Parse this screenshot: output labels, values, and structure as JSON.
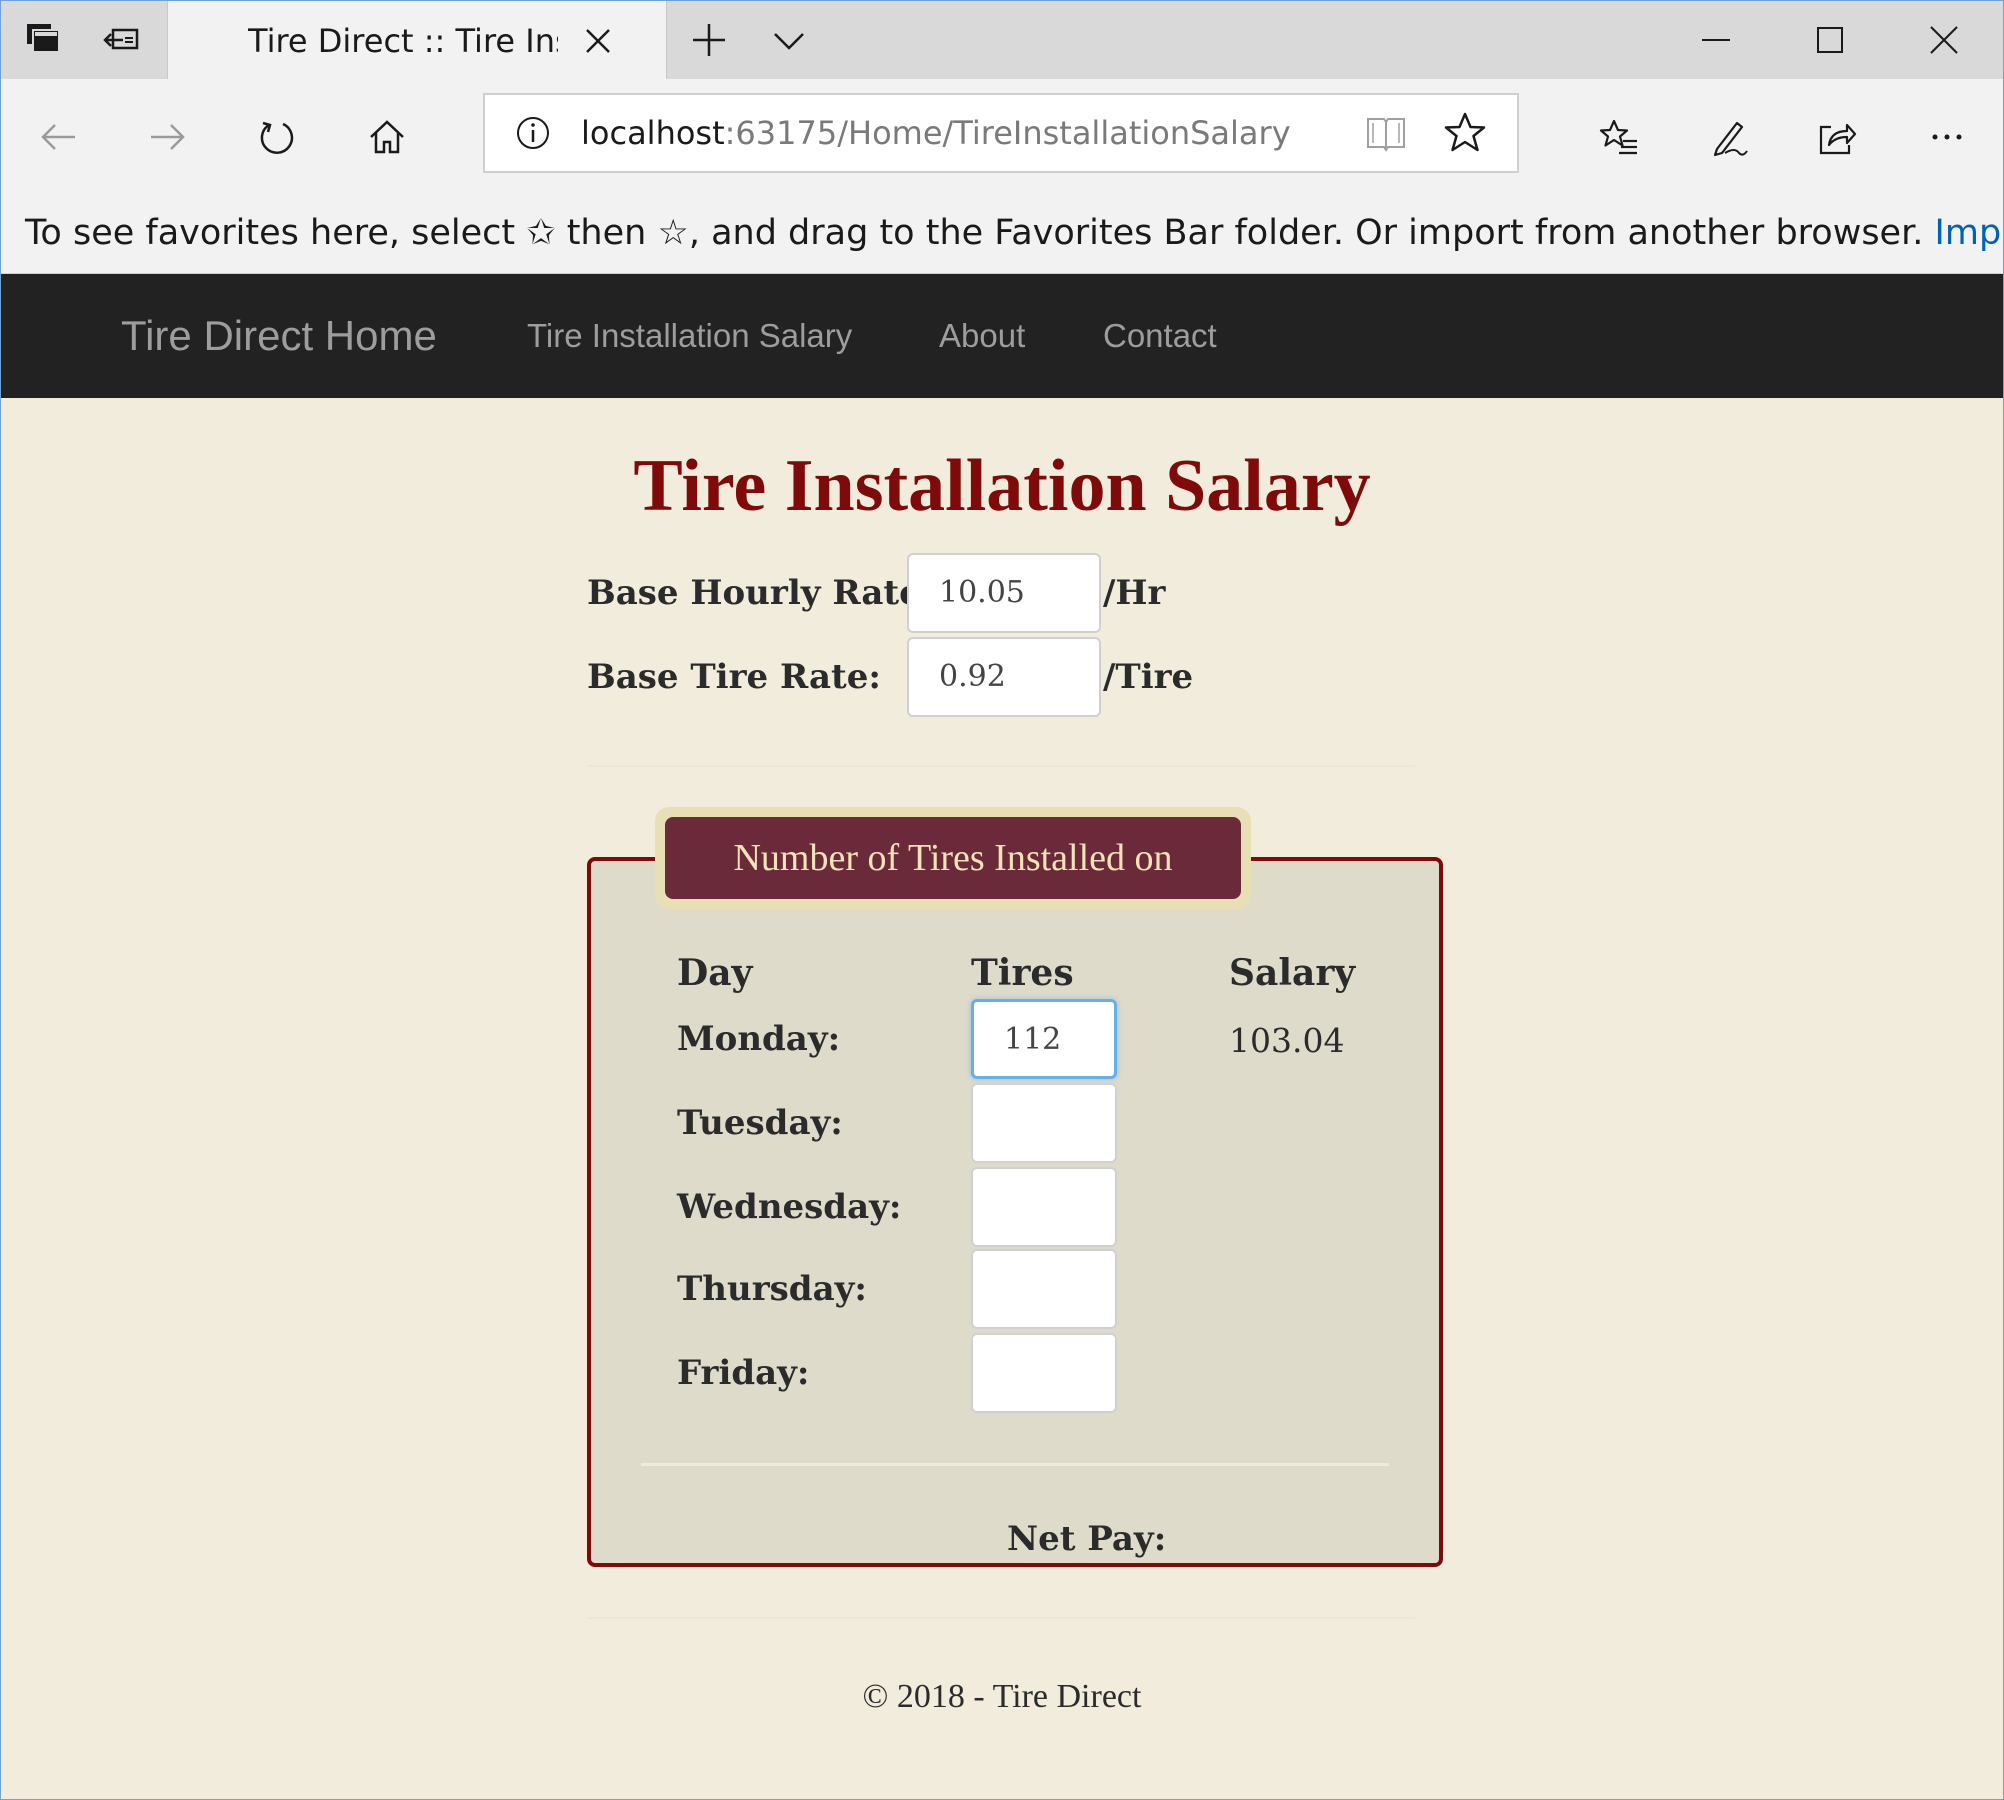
{
  "browser": {
    "tab_title": "Tire Direct :: Tire Installa",
    "url_host": "localhost",
    "url_path": ":63175/Home/TireInstallationSalary",
    "favorites_message": "To see favorites here, select  ✩  then ☆, and drag to the Favorites Bar folder. Or import from another browser.",
    "favorites_link": "Import fav",
    "icons": {
      "tab_preview": "tab-preview-icon",
      "tab_aside": "set-tabs-aside-icon",
      "tab_close": "close-icon",
      "new_tab": "plus-icon",
      "tab_menu": "chevron-down-icon",
      "minimize": "minimize-icon",
      "maximize": "maximize-icon",
      "close_window": "close-icon",
      "back": "back-arrow-icon",
      "forward": "forward-arrow-icon",
      "refresh": "refresh-icon",
      "home": "home-icon",
      "site_info": "info-icon",
      "reading_view": "book-icon",
      "favorite": "star-icon",
      "favorites_hub": "favorites-list-icon",
      "notes": "pen-icon",
      "share": "share-icon",
      "more": "ellipsis-icon"
    }
  },
  "nav": {
    "brand": "Tire Direct Home",
    "links": [
      "Tire Installation Salary",
      "About",
      "Contact"
    ]
  },
  "page": {
    "title": "Tire Installation Salary",
    "base_hourly_label": "Base Hourly Rate:",
    "base_hourly_value": "10.05",
    "base_hourly_unit": "/Hr",
    "base_tire_label": "Base Tire Rate:",
    "base_tire_value": "0.92",
    "base_tire_unit": "/Tire",
    "legend": "Number of Tires Installed on",
    "columns": {
      "day": "Day",
      "tires": "Tires",
      "salary": "Salary"
    },
    "days": [
      {
        "label": "Monday:",
        "tires": "112",
        "salary": "103.04"
      },
      {
        "label": "Tuesday:",
        "tires": "",
        "salary": ""
      },
      {
        "label": "Wednesday:",
        "tires": "",
        "salary": ""
      },
      {
        "label": "Thursday:",
        "tires": "",
        "salary": ""
      },
      {
        "label": "Friday:",
        "tires": "",
        "salary": ""
      }
    ],
    "net_pay_label": "Net Pay:",
    "footer": "© 2018 - Tire Direct"
  },
  "colors": {
    "title": "#7f0a0a",
    "navbar": "#222222",
    "page_bg": "#f2ecdc",
    "fieldset_bg": "#dedbcb",
    "legend_bg": "#6b2a3a",
    "link": "#0063b1"
  }
}
